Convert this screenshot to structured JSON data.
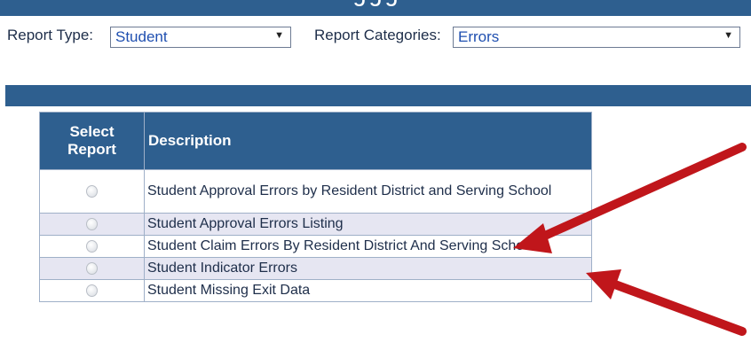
{
  "filters": {
    "report_type_label": "Report Type:",
    "report_type_value": "Student",
    "report_categories_label": "Report Categories:",
    "report_categories_value": "Errors"
  },
  "table": {
    "headers": {
      "select": "Select Report",
      "description": "Description"
    },
    "rows": [
      {
        "description": "Student Approval Errors by Resident District and Serving School",
        "selected": false
      },
      {
        "description": "Student Approval Errors Listing",
        "selected": false
      },
      {
        "description": "Student Claim Errors By Resident District And Serving School",
        "selected": false
      },
      {
        "description": "Student Indicator Errors",
        "selected": false
      },
      {
        "description": "Student Missing Exit Data",
        "selected": false
      }
    ]
  },
  "colors": {
    "header_blue": "#2e5f8f",
    "row_alt": "#e6e6f2",
    "annotation_arrow": "#c0161b",
    "link_blue": "#1f4fb0"
  },
  "annotations": [
    {
      "type": "arrow",
      "points_to": "Student Approval Errors Listing"
    },
    {
      "type": "arrow",
      "points_to": "Student Claim Errors By Resident District And Serving School"
    }
  ]
}
